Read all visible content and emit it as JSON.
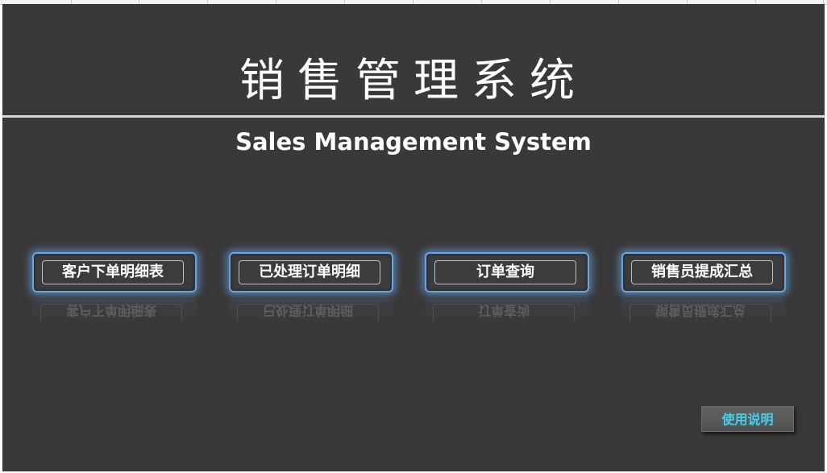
{
  "header": {
    "title_cn": "销售管理系统",
    "title_en": "Sales Management System"
  },
  "nav": {
    "items": [
      {
        "label": "客户下单明细表"
      },
      {
        "label": "已处理订单明细"
      },
      {
        "label": "订单查询"
      },
      {
        "label": "销售员提成汇总"
      }
    ]
  },
  "footer": {
    "help_label": "使用说明"
  },
  "colors": {
    "background": "#3a3839",
    "accent_glow": "#5b9bd5",
    "help_text": "#3fd4f0",
    "text": "#ffffff"
  }
}
